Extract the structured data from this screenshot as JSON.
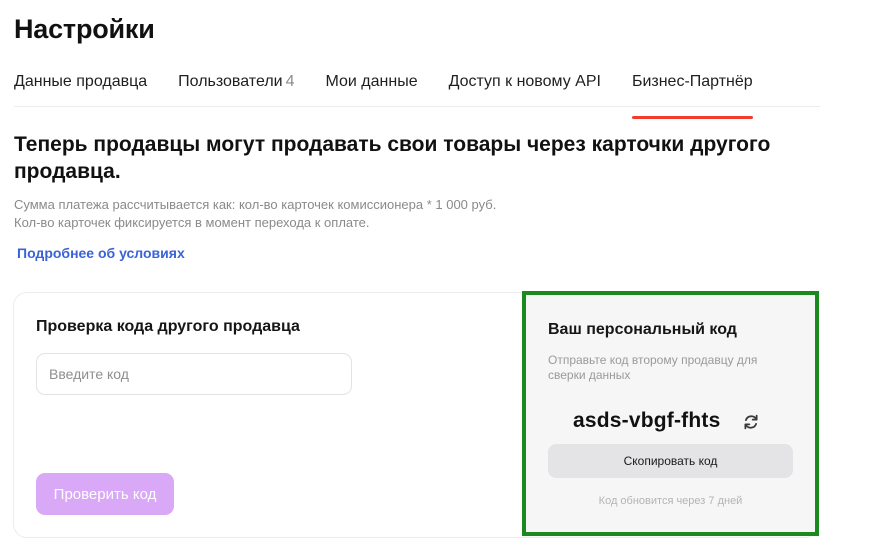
{
  "page": {
    "title": "Настройки"
  },
  "tabs": [
    {
      "label": "Данные продавца",
      "count": "",
      "active": false
    },
    {
      "label": "Пользователи",
      "count": "4",
      "active": false
    },
    {
      "label": "Мои данные",
      "count": "",
      "active": false
    },
    {
      "label": "Доступ к новому API",
      "count": "",
      "active": false
    },
    {
      "label": "Бизнес-Партнёр",
      "count": "",
      "active": true
    }
  ],
  "intro": {
    "headline": "Теперь продавцы могут продавать свои товары через карточки другого продавца.",
    "note_line1": "Сумма платежа рассчитывается как: кол-во карточек комиссионера * 1 000 руб.",
    "note_line2": "Кол-во карточек фиксируется в момент перехода к оплате.",
    "details_link": "Подробнее об условиях"
  },
  "verify": {
    "title": "Проверка кода другого продавца",
    "input_placeholder": "Введите код",
    "input_value": "",
    "button_label": "Проверить код"
  },
  "personal_code": {
    "title": "Ваш персональный код",
    "description": "Отправьте код второму продавцу для сверки данных",
    "code": "asds-vbgf-fhts",
    "copy_button": "Скопировать код",
    "expiry_note": "Код обновится через 7 дней",
    "refresh_icon": "refresh-icon"
  },
  "colors": {
    "accent_tab_underline": "#f33c2e",
    "link": "#3a63d6",
    "verify_button": "#d9a8f6",
    "highlight_border": "#1a8a1f"
  }
}
